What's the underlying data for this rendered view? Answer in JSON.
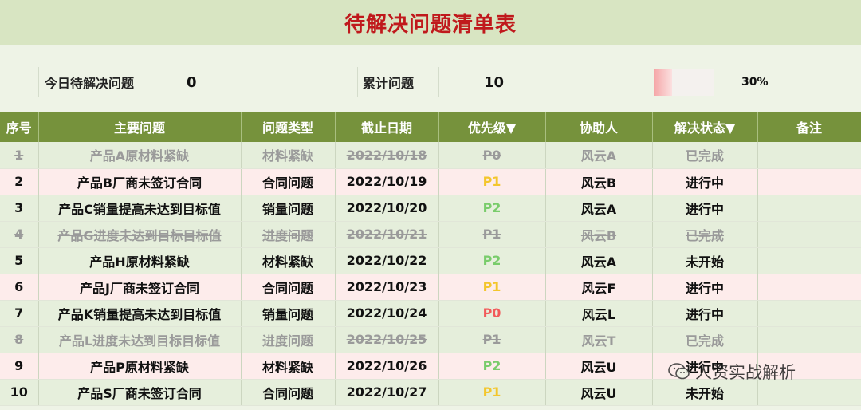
{
  "title": "待解决问题清单表",
  "stats": {
    "today_label": "今日待解决问题",
    "today_value": "0",
    "total_label": "累计问题",
    "total_value": "10",
    "progress": 0.3,
    "progress_text": "30%"
  },
  "columns": [
    "序号",
    "主要问题",
    "问题类型",
    "截止日期",
    "优先级▼",
    "协助人",
    "解决状态▼",
    "备注"
  ],
  "rows": [
    {
      "no": "1",
      "issue": "产品A原材料紧缺",
      "type": "材料紧缺",
      "date": "2022/10/18",
      "priority": "P0",
      "helper": "风云A",
      "status": "已完成",
      "note": ""
    },
    {
      "no": "2",
      "issue": "产品B厂商未签订合同",
      "type": "合同问题",
      "date": "2022/10/19",
      "priority": "P1",
      "helper": "风云B",
      "status": "进行中",
      "note": ""
    },
    {
      "no": "3",
      "issue": "产品C销量提高未达到目标值",
      "type": "销量问题",
      "date": "2022/10/20",
      "priority": "P2",
      "helper": "风云A",
      "status": "进行中",
      "note": ""
    },
    {
      "no": "4",
      "issue": "产品G进度未达到目标目标值",
      "type": "进度问题",
      "date": "2022/10/21",
      "priority": "P1",
      "helper": "风云B",
      "status": "已完成",
      "note": ""
    },
    {
      "no": "5",
      "issue": "产品H原材料紧缺",
      "type": "材料紧缺",
      "date": "2022/10/22",
      "priority": "P2",
      "helper": "风云A",
      "status": "未开始",
      "note": ""
    },
    {
      "no": "6",
      "issue": "产品J厂商未签订合同",
      "type": "合同问题",
      "date": "2022/10/23",
      "priority": "P1",
      "helper": "风云F",
      "status": "进行中",
      "note": ""
    },
    {
      "no": "7",
      "issue": "产品K销量提高未达到目标值",
      "type": "销量问题",
      "date": "2022/10/24",
      "priority": "P0",
      "helper": "风云L",
      "status": "进行中",
      "note": ""
    },
    {
      "no": "8",
      "issue": "产品L进度未达到目标目标值",
      "type": "进度问题",
      "date": "2022/10/25",
      "priority": "P1",
      "helper": "风云T",
      "status": "已完成",
      "note": ""
    },
    {
      "no": "9",
      "issue": "产品P原材料紧缺",
      "type": "材料紧缺",
      "date": "2022/10/26",
      "priority": "P2",
      "helper": "风云U",
      "status": "进行中",
      "note": ""
    },
    {
      "no": "10",
      "issue": "产品S厂商未签订合同",
      "type": "合同问题",
      "date": "2022/10/27",
      "priority": "P1",
      "helper": "风云U",
      "status": "未开始",
      "note": ""
    }
  ],
  "watermark": "人资实战解析",
  "colors": {
    "title": "#c0191c",
    "header": "#76923c",
    "done_text": "#9a9a9a",
    "p0": "#f25a5a",
    "p1": "#f3c62c",
    "p2": "#79cc6b"
  }
}
